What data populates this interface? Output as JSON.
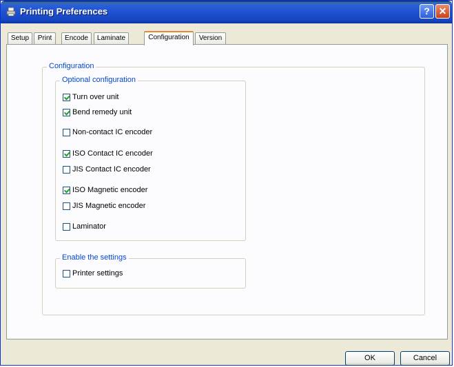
{
  "window": {
    "title": "Printing Preferences",
    "help_label": "?",
    "close_label": "✕"
  },
  "tabs": [
    {
      "label": "Setup"
    },
    {
      "label": "Print"
    },
    {
      "label": "Encode"
    },
    {
      "label": "Laminate"
    },
    {
      "label": "Configuration",
      "active": true
    },
    {
      "label": "Version"
    }
  ],
  "configuration": {
    "legend": "Configuration",
    "optional": {
      "legend": "Optional configuration",
      "items": [
        {
          "label": "Turn over unit",
          "checked": true
        },
        {
          "label": "Bend remedy unit",
          "checked": true
        },
        {
          "label": "Non-contact IC encoder",
          "checked": false
        },
        {
          "label": "ISO Contact IC encoder",
          "checked": true
        },
        {
          "label": "JIS Contact IC encoder",
          "checked": false
        },
        {
          "label": "ISO Magnetic encoder",
          "checked": true
        },
        {
          "label": "JIS Magnetic encoder",
          "checked": false
        },
        {
          "label": "Laminator",
          "checked": false
        }
      ]
    },
    "enable": {
      "legend": "Enable the settings",
      "items": [
        {
          "label": "Printer settings",
          "checked": false
        }
      ]
    }
  },
  "buttons": {
    "ok": "OK",
    "cancel": "Cancel"
  }
}
